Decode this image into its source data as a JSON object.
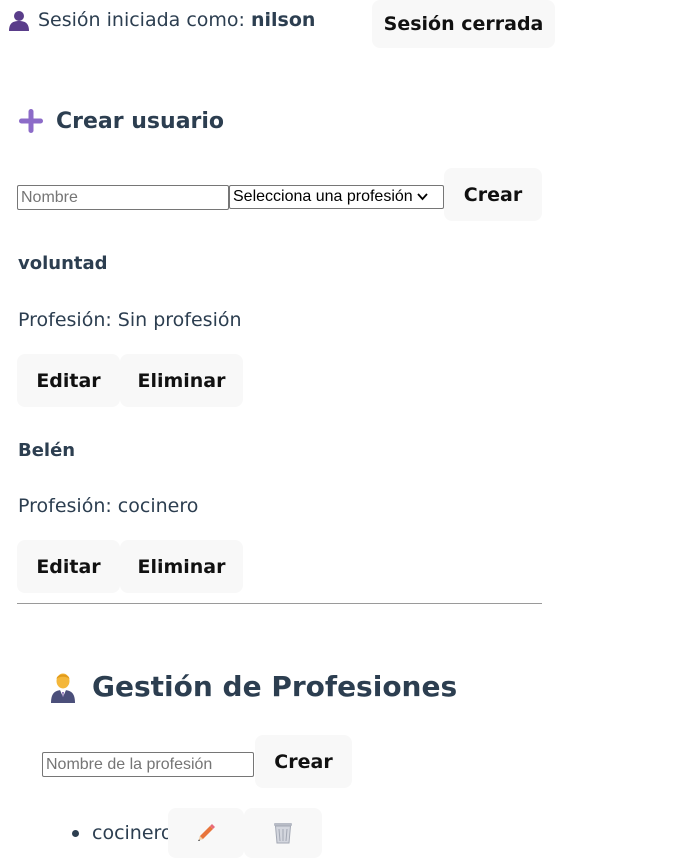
{
  "session": {
    "label": "Sesión iniciada como:",
    "username": "nilson",
    "logout_label": "Sesión cerrada"
  },
  "create_user": {
    "title": "Crear usuario",
    "name_placeholder": "Nombre",
    "profession_select_value": "Selecciona una profesión",
    "create_label": "Crear"
  },
  "users": [
    {
      "name": "voluntad",
      "profession": "Profesión: Sin profesión",
      "edit_label": "Editar",
      "delete_label": "Eliminar"
    },
    {
      "name": "Belén",
      "profession": "Profesión: cocinero",
      "edit_label": "Editar",
      "delete_label": "Eliminar"
    }
  ],
  "professions": {
    "title": "Gestión de Profesiones",
    "name_placeholder": "Nombre de la profesión",
    "create_label": "Crear",
    "items": [
      {
        "name": "cocinero",
        "edit_icon": "pencil-icon",
        "delete_icon": "wastebasket-icon"
      }
    ]
  },
  "icons": {
    "session": "bust-silhouette-icon",
    "create_user": "plus-icon",
    "professions": "office-worker-icon"
  },
  "colors": {
    "text": "#2c3e50",
    "button_bg": "#f8f8f8",
    "plus_icon": "#8c6bc8",
    "pencil": "#e8743b"
  }
}
